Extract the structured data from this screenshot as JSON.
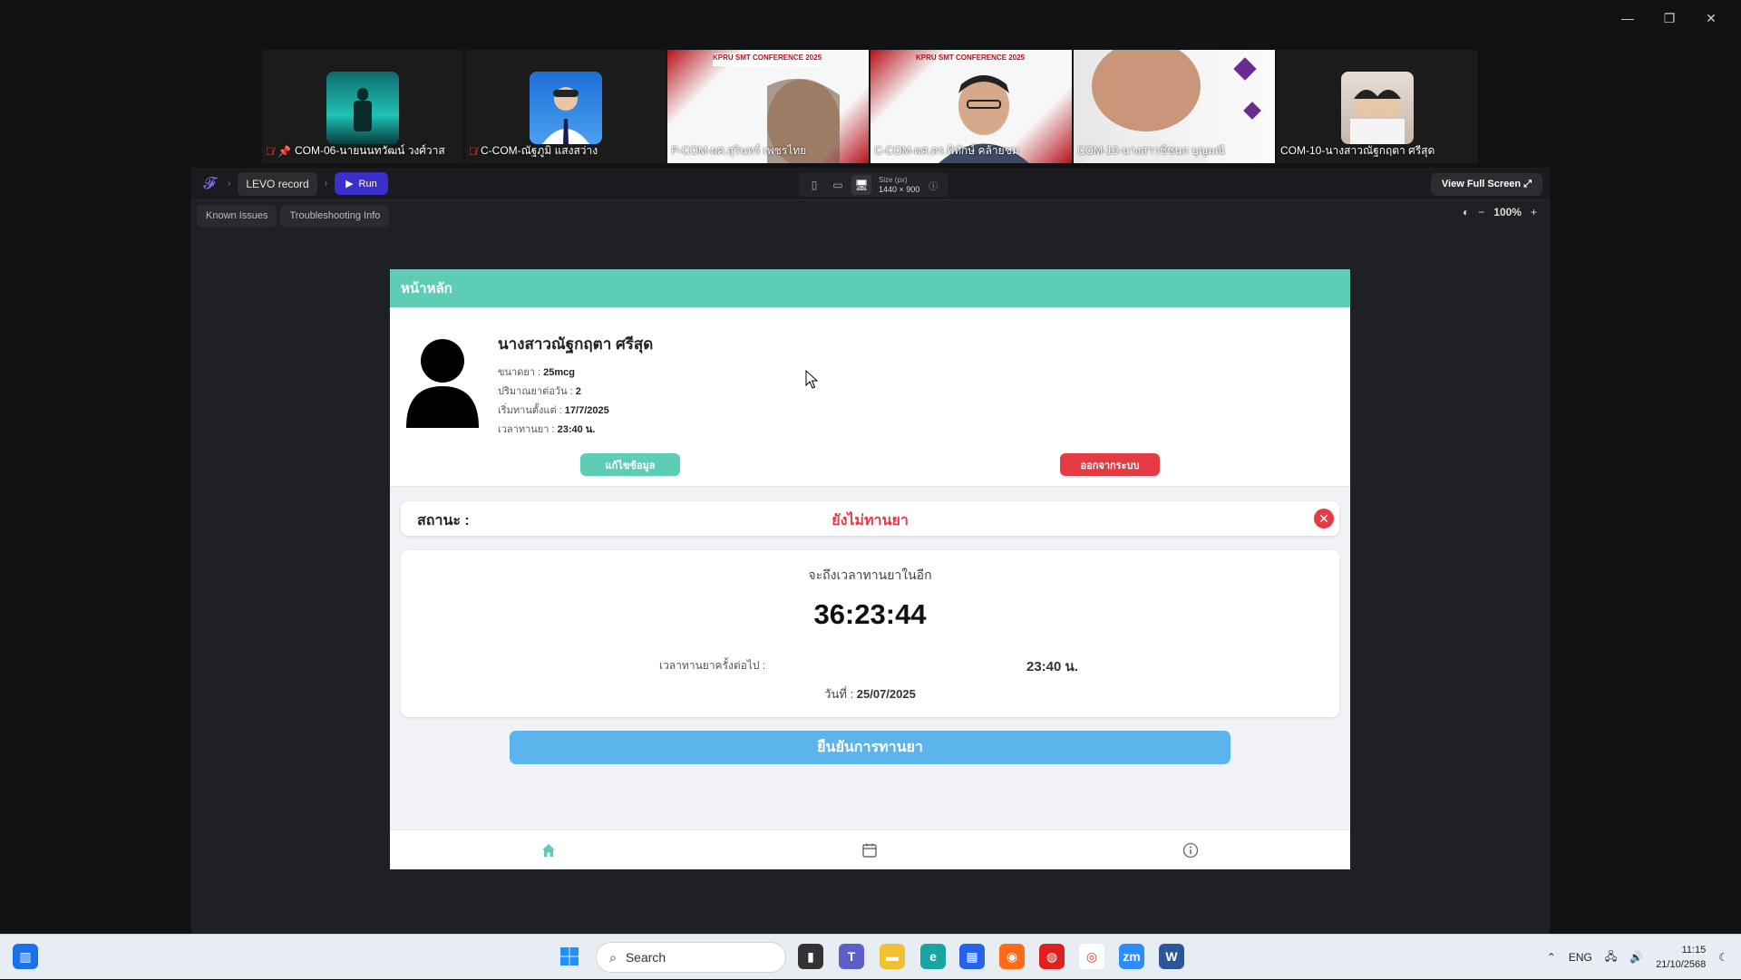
{
  "participants": [
    {
      "name": "COM-06-นายนนทวัฒน์ วงศ์วาส",
      "muted": true,
      "pinned": true
    },
    {
      "name": "C-COM-ณัฐภูมิ แสงสว่าง",
      "muted": true,
      "pinned": false
    },
    {
      "name": "P-COM-ผศ.สุรินทร์ เพชรไทย",
      "muted": false,
      "pinned": false
    },
    {
      "name": "C-COM-ผศ.ดร.พิทักษ์ คล้ายชม",
      "muted": false,
      "pinned": false
    },
    {
      "name": "COM-10-นางสาวชิชนก บุญมณี",
      "muted": false,
      "pinned": false
    },
    {
      "name": "COM-10-นางสาวณัฐกฤตา ศรีสุด",
      "muted": false,
      "pinned": false
    }
  ],
  "conference_banner": "KPRU SMT CONFERENCE 2025",
  "builder": {
    "project": "LEVO record",
    "run_label": "Run",
    "size_label": "Size (px)",
    "size_value": "1440 × 900",
    "full_screen_label": "View Full Screen",
    "known_issues": "Known Issues",
    "troubleshooting": "Troubleshooting Info",
    "zoom": "100%"
  },
  "app": {
    "header_title": "หน้าหลัก",
    "patient_name": "นางสาวณัฐกฤตา ศรีสุด",
    "dose_label": "ขนาดยา :",
    "dose_value": "25mcg",
    "per_day_label": "ปริมาณยาต่อวัน :",
    "per_day_value": "2",
    "start_label": "เริ่มทานตั้งแต่ :",
    "start_value": "17/7/2025",
    "time_label": "เวลาทานยา :",
    "time_value": "23:40 น.",
    "edit_button": "แก้ไขข้อมูล",
    "logout_button": "ออกจากระบบ",
    "status_label": "สถานะ :",
    "status_value": "ยังไม่ทานยา",
    "countdown_title": "จะถึงเวลาทานยาในอีก",
    "countdown_value": "36:23:44",
    "next_label": "เวลาทานยาครั้งต่อไป :",
    "next_value": "23:40 น.",
    "date_label": "วันที่ :",
    "date_value": "25/07/2025",
    "confirm_button": "ยืนยันการทานยา"
  },
  "taskbar": {
    "search_placeholder": "Search",
    "language": "ENG",
    "time": "11:15",
    "date": "21/10/2568"
  },
  "colors": {
    "accent_teal": "#5ecdb6",
    "danger_red": "#e43b45",
    "confirm_blue": "#5cb4ec",
    "run_purple": "#3b2fc9"
  }
}
